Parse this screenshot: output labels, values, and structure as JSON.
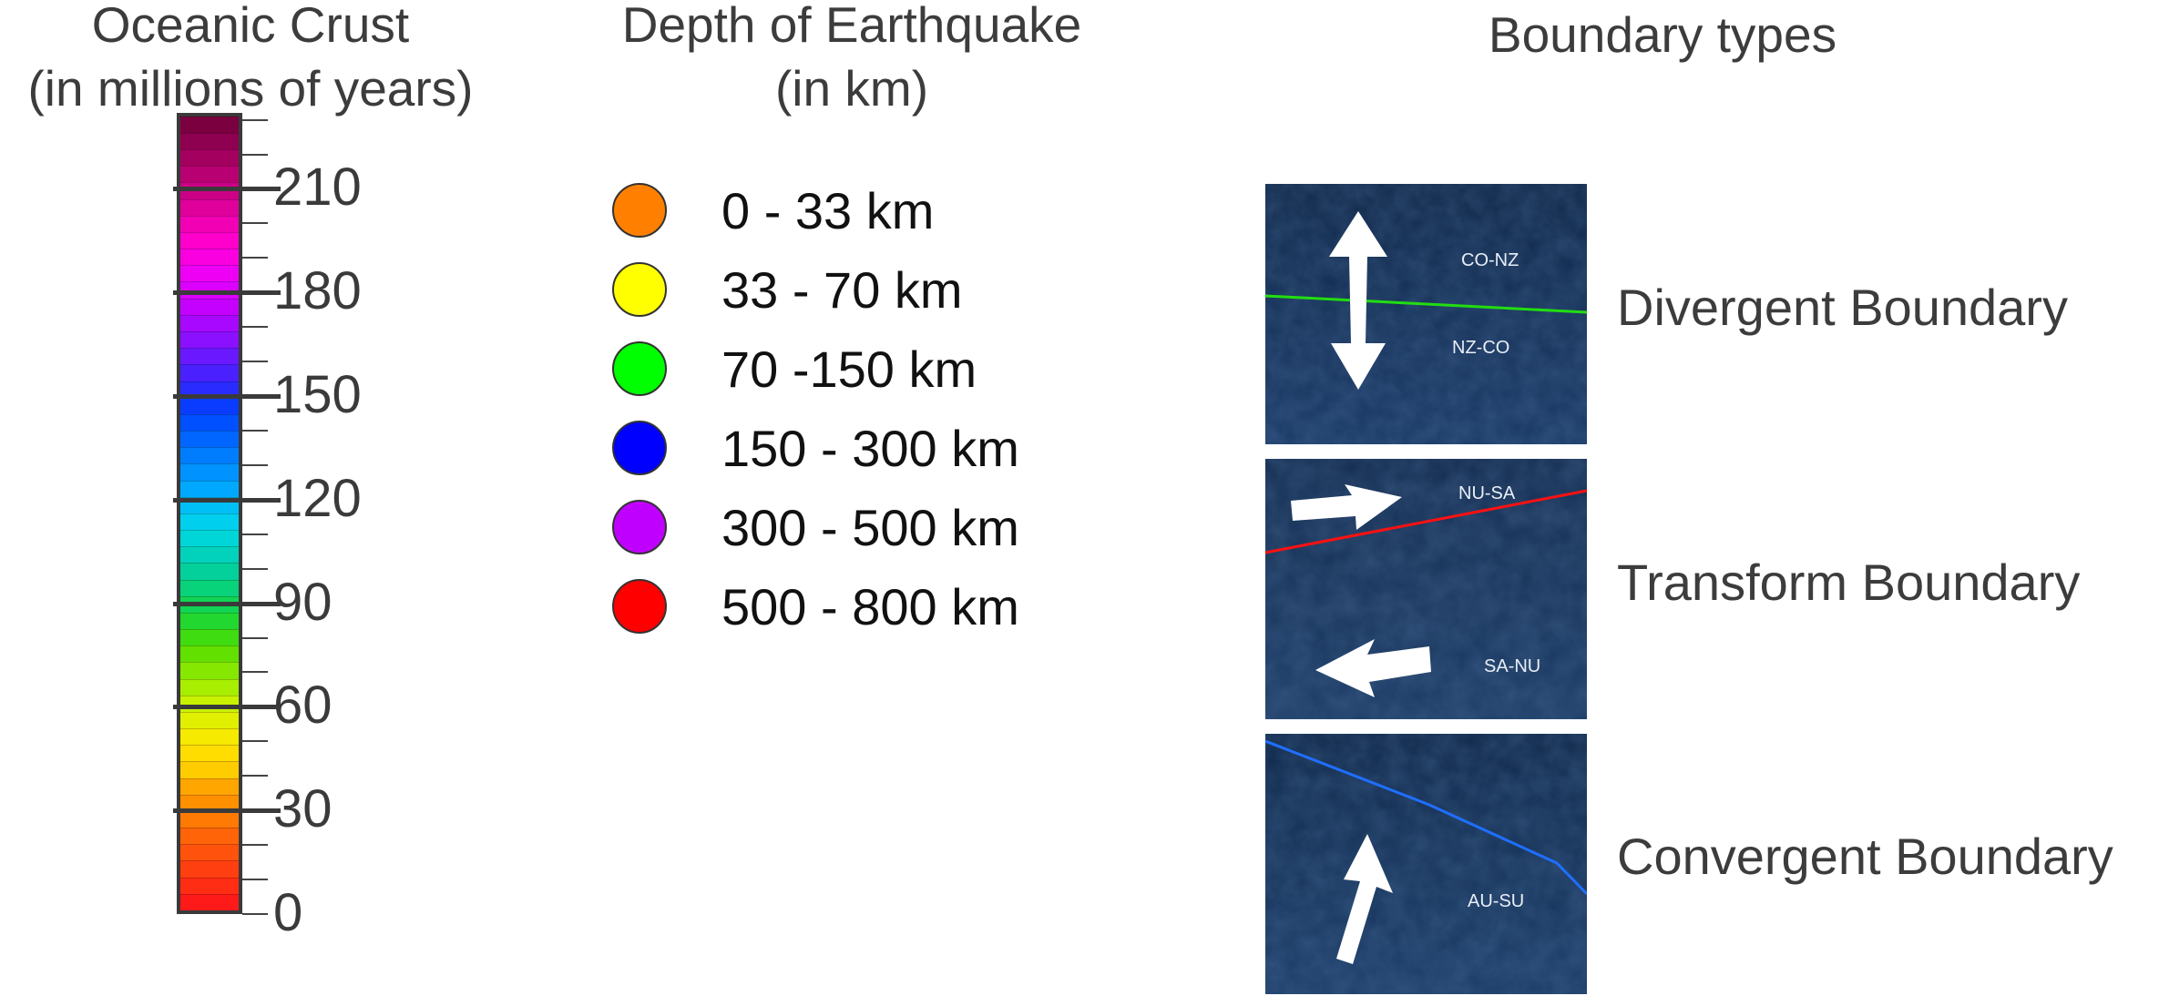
{
  "crust_legend": {
    "title_line1": "Oceanic Crust",
    "title_line2": "(in millions of years)",
    "scale": {
      "min": 0,
      "max": 232
    },
    "tick_values": [
      "0",
      "30",
      "60",
      "90",
      "120",
      "150",
      "180",
      "210"
    ],
    "colors": [
      "#ff1a1a",
      "#ff2d14",
      "#ff3f10",
      "#ff520c",
      "#ff6508",
      "#ff7a04",
      "#ff9000",
      "#ffa600",
      "#ffcc00",
      "#ffdd00",
      "#f5ea00",
      "#e0f000",
      "#c8f200",
      "#a8ee00",
      "#86e800",
      "#62e000",
      "#3edc10",
      "#22d830",
      "#12d454",
      "#08d27a",
      "#04d09c",
      "#02d2bc",
      "#00d6d8",
      "#00cfee",
      "#00bff7",
      "#00a8ff",
      "#0092ff",
      "#007cff",
      "#0066ff",
      "#0050ff",
      "#0a3cff",
      "#2a2cff",
      "#4a20ff",
      "#6a18ff",
      "#8a10ff",
      "#a808ff",
      "#c400ff",
      "#dc00ff",
      "#ee00f4",
      "#fa00e0",
      "#ff00cc",
      "#f200b4",
      "#e0009c",
      "#cc0086",
      "#b80072",
      "#a30060",
      "#8e0050",
      "#7a0040"
    ]
  },
  "depth_legend": {
    "title_line1": "Depth of Earthquake",
    "title_line2": "(in km)",
    "items": [
      {
        "label": "0 - 33 km",
        "color": "#ff8000"
      },
      {
        "label": "33 - 70 km",
        "color": "#ffff00"
      },
      {
        "label": "70 -150 km",
        "color": "#00ff00"
      },
      {
        "label": "150 - 300 km",
        "color": "#0000ff"
      },
      {
        "label": "300 - 500 km",
        "color": "#c000ff"
      },
      {
        "label": "500 - 800 km",
        "color": "#ff0000"
      }
    ]
  },
  "boundary_legend": {
    "title": "Boundary types",
    "panels": [
      {
        "caption": "Divergent Boundary",
        "line_color": "#22dd11",
        "tag_top": "CO-NZ",
        "tag_bottom": "NZ-CO",
        "arrow_icon": "double-vertical-arrow-icon"
      },
      {
        "caption": "Transform Boundary",
        "line_color": "#ff1111",
        "tag_top": "NU-SA",
        "tag_bottom": "SA-NU",
        "arrow_icon": "opposing-horizontal-arrows-icon"
      },
      {
        "caption": "Convergent Boundary",
        "line_color": "#1f6fff",
        "tag_top": "AU-SU",
        "arrow_icon": "up-arrow-icon"
      }
    ]
  }
}
